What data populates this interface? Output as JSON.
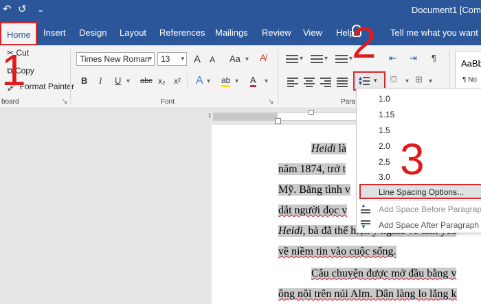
{
  "titlebar": {
    "save_glyph": "↶",
    "redo_glyph": "↺",
    "qat_more": "₌",
    "doc_title": "Document1 [Com"
  },
  "tabs": [
    "Home",
    "Insert",
    "Design",
    "Layout",
    "References",
    "Mailings",
    "Review",
    "View",
    "Help"
  ],
  "tell_me": "Tell me what you want to",
  "clipboard": {
    "cut": "Cut",
    "copy": "Copy",
    "format_painter": "Format Painter",
    "label": "board"
  },
  "font": {
    "name": "Times New Roman",
    "size": "13",
    "grow": "A",
    "shrink": "A",
    "case": "Aa",
    "bold": "B",
    "italic": "I",
    "underline": "U",
    "strike": "abc",
    "subscript": "x₂",
    "superscript": "x²",
    "text_effects": "A",
    "highlight": "ab",
    "font_color": "A",
    "label": "Font"
  },
  "paragraph": {
    "label": "Para",
    "pilcrow": "¶"
  },
  "styles": {
    "style1": "AaBbC",
    "style2": "¶ No"
  },
  "ruler": {
    "mark": "1"
  },
  "document": {
    "lines": [
      {
        "pre": "",
        "italic": "Heidi",
        "text": " là"
      },
      {
        "pre": "năm 1874, trở t",
        "italic": "",
        "text": ""
      },
      {
        "pre": "Mỹ. Bằng tình v",
        "italic": "",
        "text": ""
      },
      {
        "pre": "dắt người đọc v",
        "italic": "",
        "text": ""
      },
      {
        "pre": "",
        "italic": "Heidi",
        "text": ", bà đã thể hiện ý nghĩa về tình yêu"
      },
      {
        "pre": "về niềm tin vào cuộc sống.",
        "italic": "",
        "text": ""
      },
      {
        "pre": "Câu chuyện được mở đầu bằng v",
        "italic": "",
        "text": ""
      },
      {
        "pre": "ông nội trên núi Alm. Dân làng lo lắng k",
        "italic": "",
        "text": ""
      }
    ]
  },
  "menu": {
    "items": [
      "1.0",
      "1.15",
      "1.5",
      "2.0",
      "2.5",
      "3.0"
    ],
    "options": "Line Spacing Options...",
    "add_before": "Add Space Before Paragraph",
    "add_after": "Add Space After Paragraph"
  },
  "annotations": [
    "1",
    "2",
    "3"
  ],
  "colors": {
    "accent": "#2b579a",
    "highlight_red": "#d9272e",
    "annotation_red": "#e01b1b"
  }
}
